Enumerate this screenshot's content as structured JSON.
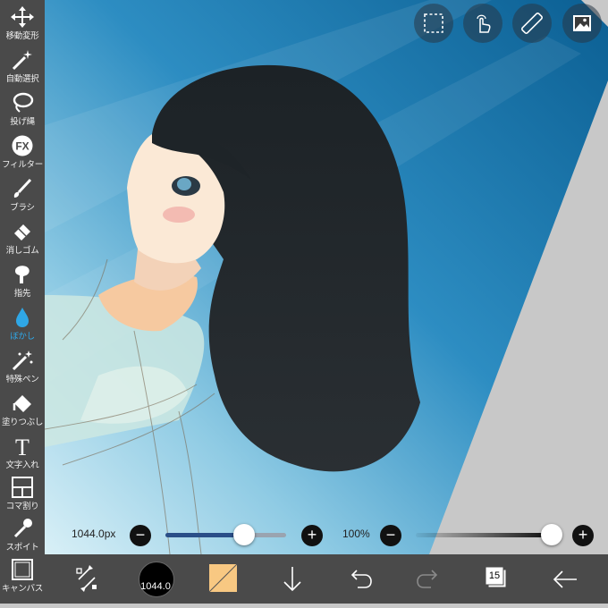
{
  "toolbar": {
    "items": [
      {
        "label": "移動変形",
        "icon": "move-icon"
      },
      {
        "label": "自動選択",
        "icon": "magic-wand-icon"
      },
      {
        "label": "投げ縄",
        "icon": "lasso-icon"
      },
      {
        "label": "フィルター",
        "icon": "fx-icon",
        "badge": "FX"
      },
      {
        "label": "ブラシ",
        "icon": "brush-icon"
      },
      {
        "label": "消しゴム",
        "icon": "eraser-icon"
      },
      {
        "label": "指先",
        "icon": "finger-icon"
      },
      {
        "label": "ぼかし",
        "icon": "blur-drop-icon",
        "active": true
      },
      {
        "label": "特殊ペン",
        "icon": "special-pen-icon"
      },
      {
        "label": "塗りつぶし",
        "icon": "fill-bucket-icon"
      },
      {
        "label": "文字入れ",
        "icon": "text-icon",
        "glyph": "T"
      },
      {
        "label": "コマ割り",
        "icon": "frame-divider-icon"
      },
      {
        "label": "スポイト",
        "icon": "eyedropper-icon"
      },
      {
        "label": "キャンバス",
        "icon": "canvas-icon"
      }
    ]
  },
  "top_buttons": [
    {
      "name": "selection-button",
      "icon": "dashed-select-icon"
    },
    {
      "name": "gesture-button",
      "icon": "hand-tap-icon"
    },
    {
      "name": "ruler-button",
      "icon": "ruler-icon"
    },
    {
      "name": "material-button",
      "icon": "image-icon"
    }
  ],
  "brush_size": {
    "value_text": "1044.0px",
    "level": 0.68,
    "minus": "−",
    "plus": "+"
  },
  "opacity": {
    "value_text": "100%",
    "level": 1.0,
    "minus": "−",
    "plus": "+"
  },
  "bottom_bar": {
    "color_value": "1044.0",
    "layer_count": "15",
    "swap_icon": "swap-arrows-icon",
    "download_icon": "arrow-down-icon",
    "undo_icon": "undo-icon",
    "redo_icon": "redo-icon",
    "layers_icon": "layers-icon",
    "back_icon": "arrow-left-icon"
  },
  "colors": {
    "toolbar_bg": "#4a4a4a",
    "active_tool": "#2fa7e6",
    "brush_track": "#2a4e88",
    "secondary_color": "#f8c882"
  }
}
